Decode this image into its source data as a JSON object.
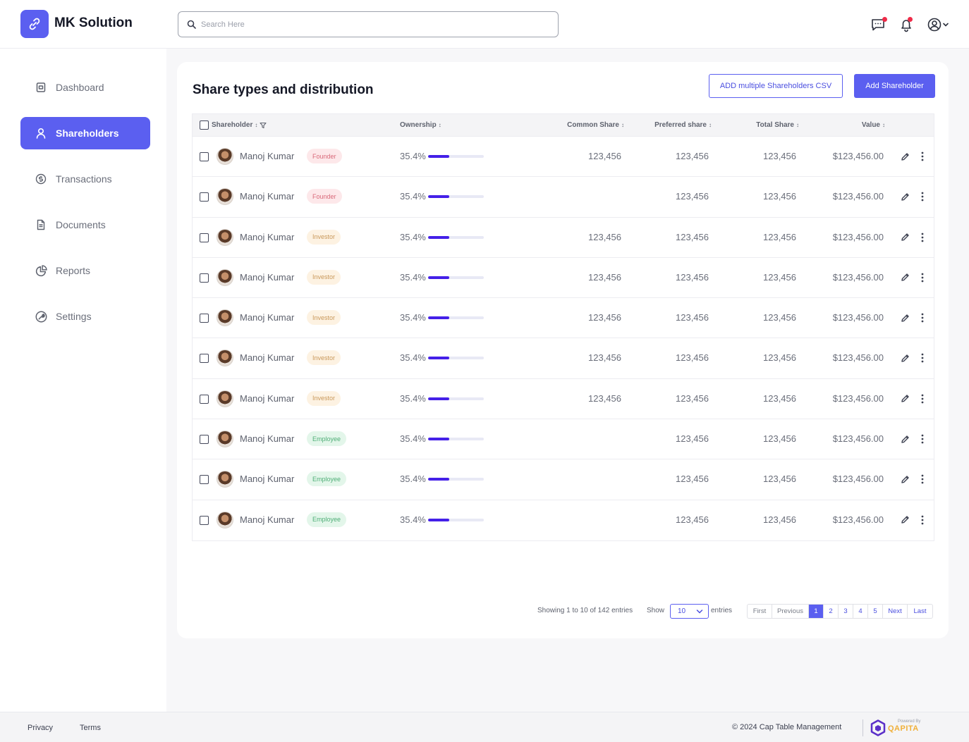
{
  "header": {
    "brand": "MK Solution",
    "search_placeholder": "Search Here"
  },
  "sidebar": {
    "items": [
      {
        "label": "Dashboard",
        "icon": "dashboard-icon"
      },
      {
        "label": "Shareholders",
        "icon": "user-icon",
        "active": true
      },
      {
        "label": "Transactions",
        "icon": "dollar-icon"
      },
      {
        "label": "Documents",
        "icon": "document-icon"
      },
      {
        "label": "Reports",
        "icon": "pie-chart-icon"
      },
      {
        "label": "Settings",
        "icon": "wrench-icon"
      }
    ]
  },
  "main": {
    "title": "Share types and distribution",
    "add_csv_label": "ADD multiple Shareholders  CSV",
    "add_label": "Add Shareholder",
    "columns": {
      "shareholder": "Shareholder",
      "ownership": "Ownership",
      "common": "Common Share",
      "preferred": "Preferred share",
      "total": "Total Share",
      "value": "Value"
    },
    "rows": [
      {
        "name": "Manoj Kumar",
        "role": "Founder",
        "role_type": "founder",
        "ownership": "35.4%",
        "ownership_fraction": 0.38,
        "common": "123,456",
        "preferred": "123,456",
        "total": "123,456",
        "value": "$123,456.00"
      },
      {
        "name": "Manoj Kumar",
        "role": "Founder",
        "role_type": "founder",
        "ownership": "35.4%",
        "ownership_fraction": 0.38,
        "common": "",
        "preferred": "123,456",
        "total": "123,456",
        "value": "$123,456.00"
      },
      {
        "name": "Manoj Kumar",
        "role": "Investor",
        "role_type": "investor",
        "ownership": "35.4%",
        "ownership_fraction": 0.38,
        "common": "123,456",
        "preferred": "123,456",
        "total": "123,456",
        "value": "$123,456.00"
      },
      {
        "name": "Manoj Kumar",
        "role": "Investor",
        "role_type": "investor",
        "ownership": "35.4%",
        "ownership_fraction": 0.38,
        "common": "123,456",
        "preferred": "123,456",
        "total": "123,456",
        "value": "$123,456.00"
      },
      {
        "name": "Manoj Kumar",
        "role": "Investor",
        "role_type": "investor",
        "ownership": "35.4%",
        "ownership_fraction": 0.38,
        "common": "123,456",
        "preferred": "123,456",
        "total": "123,456",
        "value": "$123,456.00"
      },
      {
        "name": "Manoj Kumar",
        "role": "Investor",
        "role_type": "investor",
        "ownership": "35.4%",
        "ownership_fraction": 0.38,
        "common": "123,456",
        "preferred": "123,456",
        "total": "123,456",
        "value": "$123,456.00"
      },
      {
        "name": "Manoj Kumar",
        "role": "Investor",
        "role_type": "investor",
        "ownership": "35.4%",
        "ownership_fraction": 0.38,
        "common": "123,456",
        "preferred": "123,456",
        "total": "123,456",
        "value": "$123,456.00"
      },
      {
        "name": "Manoj Kumar",
        "role": "Employee",
        "role_type": "employee",
        "ownership": "35.4%",
        "ownership_fraction": 0.38,
        "common": "",
        "preferred": "123,456",
        "total": "123,456",
        "value": "$123,456.00"
      },
      {
        "name": "Manoj Kumar",
        "role": "Employee",
        "role_type": "employee",
        "ownership": "35.4%",
        "ownership_fraction": 0.38,
        "common": "",
        "preferred": "123,456",
        "total": "123,456",
        "value": "$123,456.00"
      },
      {
        "name": "Manoj Kumar",
        "role": "Employee",
        "role_type": "employee",
        "ownership": "35.4%",
        "ownership_fraction": 0.38,
        "common": "",
        "preferred": "123,456",
        "total": "123,456",
        "value": "$123,456.00"
      }
    ]
  },
  "pagination": {
    "info": "Showing 1 to 10 of 142 entries",
    "show_label": "Show",
    "page_size": "10",
    "entries_label": "entries",
    "first": "First",
    "previous": "Previous",
    "pages": [
      "1",
      "2",
      "3",
      "4",
      "5"
    ],
    "current_page": "1",
    "next": "Next",
    "last": "Last"
  },
  "footer": {
    "privacy": "Privacy",
    "terms": "Terms",
    "copyright": "©  2024 Cap Table Management",
    "powered_by": "Powered By",
    "partner": "QAPITA"
  },
  "colors": {
    "accent": "#5b5ff0",
    "ownership_bar": "#4420e8",
    "founder_badge": "#fde8ea",
    "investor_badge": "#fdf2e2",
    "employee_badge": "#e3f6ea"
  }
}
